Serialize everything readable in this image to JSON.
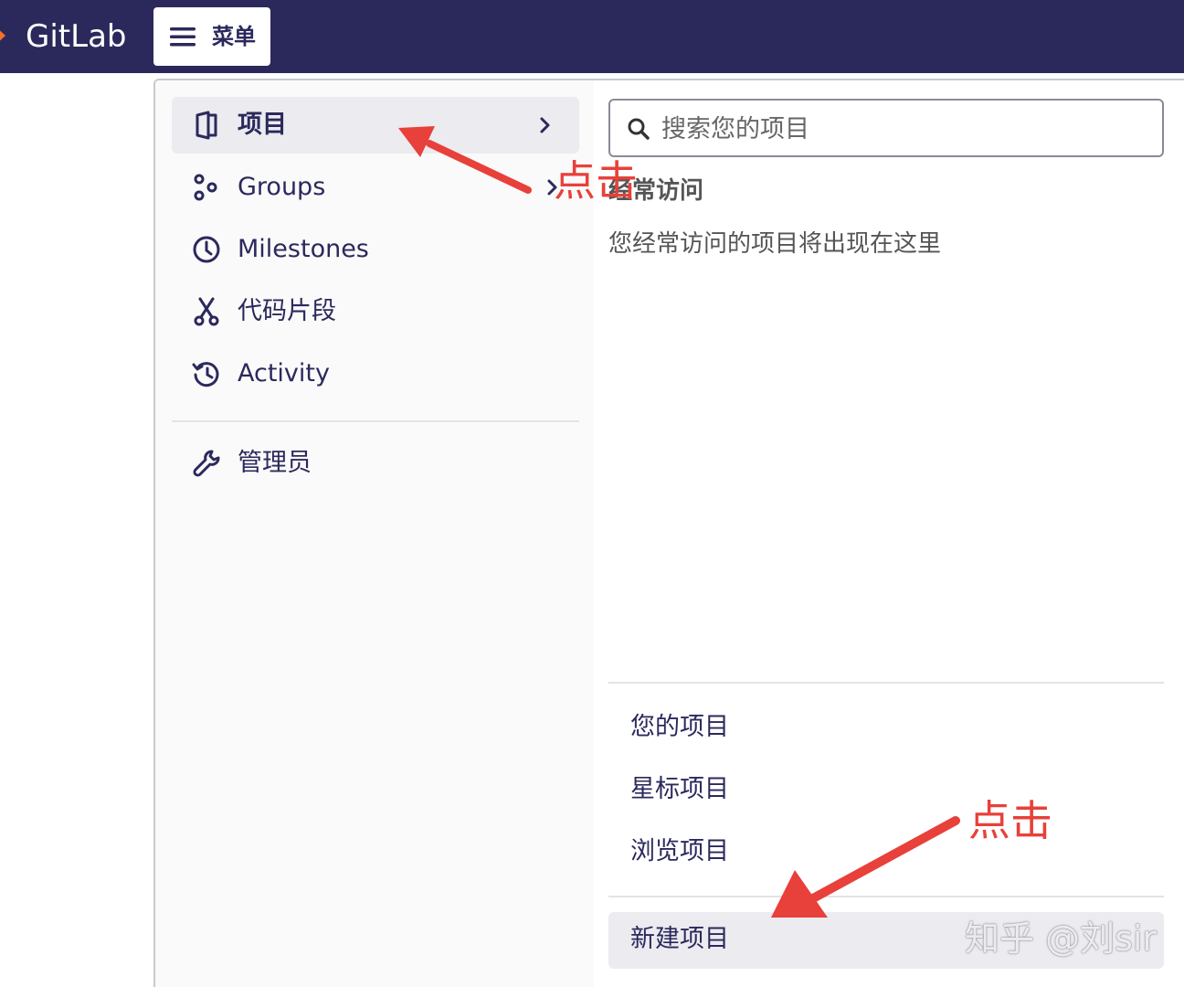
{
  "header": {
    "brand": "GitLab",
    "menu_label": "菜单"
  },
  "nav": {
    "items": [
      {
        "label": "项目",
        "icon": "project-icon",
        "active": true
      },
      {
        "label": "Groups",
        "icon": "group-icon"
      },
      {
        "label": "Milestones",
        "icon": "clock-icon"
      },
      {
        "label": "代码片段",
        "icon": "scissors-icon"
      },
      {
        "label": "Activity",
        "icon": "history-icon"
      }
    ],
    "admin_label": "管理员"
  },
  "panel": {
    "search_placeholder": "搜索您的项目",
    "frequent_heading": "经常访问",
    "frequent_empty": "您经常访问的项目将出现在这里",
    "links": [
      "您的项目",
      "星标项目",
      "浏览项目"
    ],
    "new_project": "新建项目"
  },
  "annotations": {
    "click_1": "点击",
    "click_2": "点击",
    "color": "#e8403a"
  },
  "watermark": "知乎 @刘sir",
  "colors": {
    "topbar": "#2b295c",
    "text_primary": "#2b295c",
    "active_bg": "#ebebf0"
  }
}
